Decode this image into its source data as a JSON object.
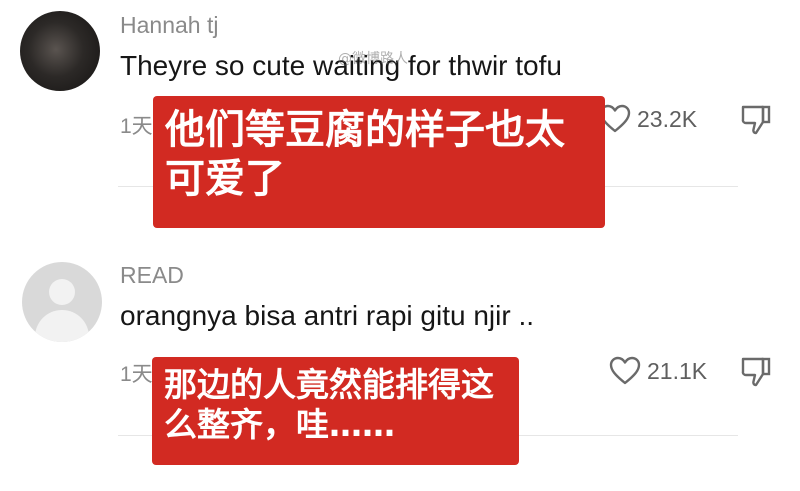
{
  "comments": [
    {
      "username": "Hannah tj",
      "text": "Theyre so cute waiting for thwir tofu",
      "time": "1天",
      "likes": "23.2K",
      "overlay_caption": "他们等豆腐的样子也太可爱了"
    },
    {
      "username": "READ",
      "text": "orangnya bisa antri rapi gitu njir ..",
      "time": "1天",
      "likes": "21.1K",
      "overlay_caption": "那边的人竟然能排得这么整齐，哇……"
    }
  ],
  "watermark": "@微博路人",
  "icons": {
    "like": "heart-outline-icon",
    "dislike": "thumbs-down-outline-icon"
  },
  "colors": {
    "overlay_red": "#d22a22",
    "username_gray": "#8a8a8a",
    "text_black": "#161616"
  }
}
